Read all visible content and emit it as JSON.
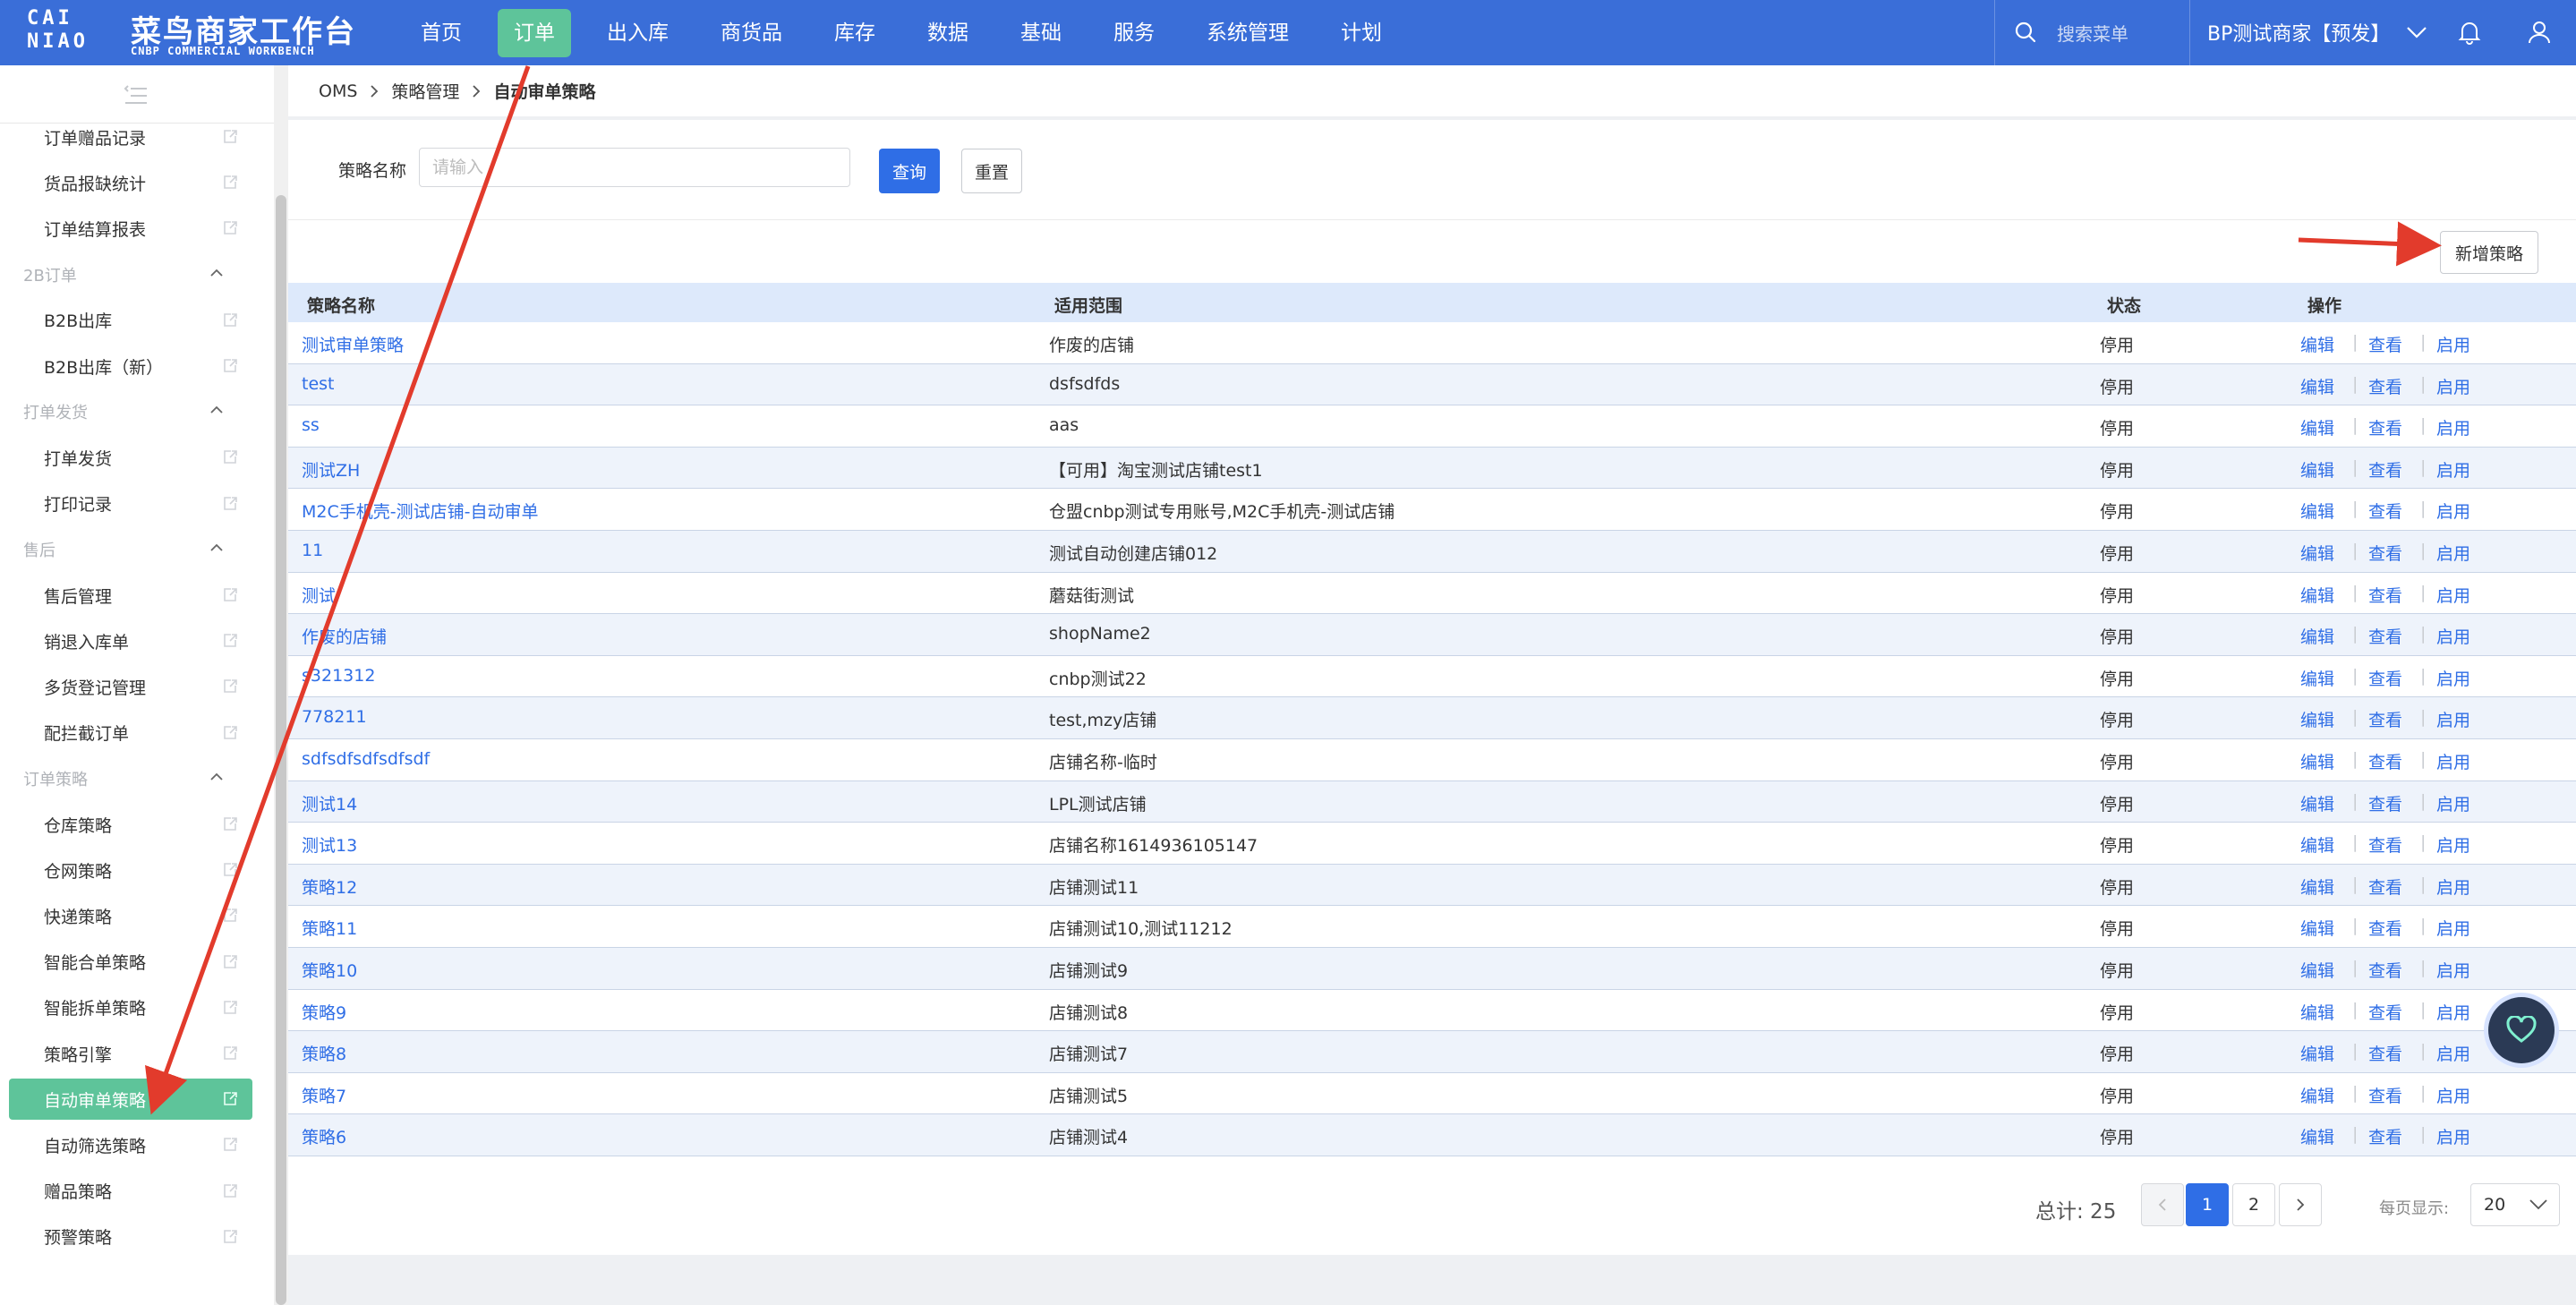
{
  "header": {
    "logo_mark": "CAI NIAO",
    "title": "菜鸟商家工作台",
    "subtitle": "CNBP COMMERCIAL WORKBENCH",
    "nav": [
      "首页",
      "订单",
      "出入库",
      "商货品",
      "库存",
      "数据",
      "基础",
      "服务",
      "系统管理",
      "计划"
    ],
    "active_nav": 1,
    "search_placeholder": "搜索菜单",
    "merchant": "BP测试商家【预发】",
    "icons": [
      "search-icon",
      "chevron-down-icon",
      "bell-icon",
      "user-icon"
    ]
  },
  "sidebar": {
    "items": [
      {
        "type": "item",
        "label": "订单赠品记录"
      },
      {
        "type": "item",
        "label": "货品报缺统计"
      },
      {
        "type": "item",
        "label": "订单结算报表"
      },
      {
        "type": "group",
        "label": "2B订单"
      },
      {
        "type": "item",
        "label": "B2B出库"
      },
      {
        "type": "item",
        "label": "B2B出库（新）"
      },
      {
        "type": "group",
        "label": "打单发货"
      },
      {
        "type": "item",
        "label": "打单发货"
      },
      {
        "type": "item",
        "label": "打印记录"
      },
      {
        "type": "group",
        "label": "售后"
      },
      {
        "type": "item",
        "label": "售后管理"
      },
      {
        "type": "item",
        "label": "销退入库单"
      },
      {
        "type": "item",
        "label": "多货登记管理"
      },
      {
        "type": "item",
        "label": "配拦截订单"
      },
      {
        "type": "group",
        "label": "订单策略"
      },
      {
        "type": "item",
        "label": "仓库策略"
      },
      {
        "type": "item",
        "label": "仓网策略"
      },
      {
        "type": "item",
        "label": "快递策略"
      },
      {
        "type": "item",
        "label": "智能合单策略"
      },
      {
        "type": "item",
        "label": "智能拆单策略"
      },
      {
        "type": "item",
        "label": "策略引擎"
      },
      {
        "type": "item",
        "label": "自动审单策略",
        "active": true
      },
      {
        "type": "item",
        "label": "自动筛选策略"
      },
      {
        "type": "item",
        "label": "赠品策略"
      },
      {
        "type": "item",
        "label": "预警策略"
      }
    ]
  },
  "breadcrumb": [
    "OMS",
    "策略管理",
    "自动审单策略"
  ],
  "filter": {
    "label": "策略名称",
    "placeholder": "请输入",
    "value": "",
    "query_label": "查询",
    "reset_label": "重置"
  },
  "add_label": "新增策略",
  "table": {
    "columns": [
      "策略名称",
      "适用范围",
      "状态",
      "操作"
    ],
    "actions": [
      "编辑",
      "查看",
      "启用"
    ],
    "rows": [
      {
        "name": "测试审单策略",
        "scope": "作废的店铺",
        "status": "停用"
      },
      {
        "name": "test",
        "scope": "dsfsdfds",
        "status": "停用"
      },
      {
        "name": "ss",
        "scope": "aas",
        "status": "停用"
      },
      {
        "name": "测试ZH",
        "scope": "【可用】淘宝测试店铺test1",
        "status": "停用"
      },
      {
        "name": "M2C手机壳-测试店铺-自动审单",
        "scope": "仓盟cnbp测试专用账号,M2C手机壳-测试店铺",
        "status": "停用"
      },
      {
        "name": "11",
        "scope": "测试自动创建店铺012",
        "status": "停用"
      },
      {
        "name": "测试",
        "scope": "蘑菇街测试",
        "status": "停用"
      },
      {
        "name": "作废的店铺",
        "scope": "shopName2",
        "status": "停用"
      },
      {
        "name": "s321312",
        "scope": "cnbp测试22",
        "status": "停用"
      },
      {
        "name": "778211",
        "scope": "test,mzy店铺",
        "status": "停用"
      },
      {
        "name": "sdfsdfsdfsdfsdf",
        "scope": "店铺名称-临时",
        "status": "停用"
      },
      {
        "name": "测试14",
        "scope": "LPL测试店铺",
        "status": "停用"
      },
      {
        "name": "测试13",
        "scope": "店铺名称1614936105147",
        "status": "停用"
      },
      {
        "name": "策略12",
        "scope": "店铺测试11",
        "status": "停用"
      },
      {
        "name": "策略11",
        "scope": "店铺测试10,测试11212",
        "status": "停用"
      },
      {
        "name": "策略10",
        "scope": "店铺测试9",
        "status": "停用"
      },
      {
        "name": "策略9",
        "scope": "店铺测试8",
        "status": "停用"
      },
      {
        "name": "策略8",
        "scope": "店铺测试7",
        "status": "停用"
      },
      {
        "name": "策略7",
        "scope": "店铺测试5",
        "status": "停用"
      },
      {
        "name": "策略6",
        "scope": "店铺测试4",
        "status": "停用"
      }
    ]
  },
  "pagination": {
    "total_label": "总计: 25",
    "pages": [
      "1",
      "2"
    ],
    "current": "1",
    "page_size_label": "每页显示:",
    "page_size": "20"
  },
  "colors": {
    "header": "#3a6ed8",
    "active_green": "#5ec49a",
    "link_blue": "#2f6ee6",
    "table_header": "#dde9fb",
    "annotation_red": "#e23b2c"
  }
}
